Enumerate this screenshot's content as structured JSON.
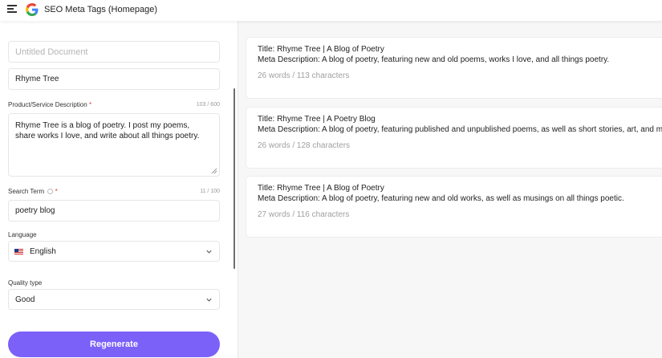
{
  "header": {
    "title": "SEO Meta Tags (Homepage)",
    "menu_icon": "hamburger-menu-icon",
    "logo": "google-logo"
  },
  "form": {
    "document_name": {
      "placeholder": "Untitled Document"
    },
    "business_name": {
      "value": "Rhyme Tree"
    },
    "description": {
      "label": "Product/Service Description",
      "required_mark": "*",
      "counter": "103 / 600",
      "value": "Rhyme Tree is a blog of poetry. I post my poems, share works I love, and write about all things poetry."
    },
    "search_term": {
      "label": "Search Term",
      "required_mark": "*",
      "counter": "11 / 100",
      "value": "poetry blog"
    },
    "language": {
      "label": "Language",
      "value": "English",
      "flag": "us-flag-icon"
    },
    "quality": {
      "label": "Quality type",
      "value": "Good"
    },
    "regenerate_label": "Regenerate"
  },
  "results": [
    {
      "title": "Title: Rhyme Tree | A Blog of Poetry",
      "meta": "Meta Description: A blog of poetry, featuring new and old poems, works I love, and all things poetry.",
      "stats": "26 words / 113 characters"
    },
    {
      "title": "Title: Rhyme Tree | A Poetry Blog",
      "meta": "Meta Description: A blog of poetry, featuring published and unpublished poems, as well as short stories, art, and more.",
      "stats": "26 words / 128 characters"
    },
    {
      "title": "Title: Rhyme Tree | A Blog of Poetry",
      "meta": "Meta Description: A blog of poetry, featuring new and old works, as well as musings on all things poetic.",
      "stats": "27 words / 116 characters"
    }
  ],
  "colors": {
    "accent": "#7b61f8",
    "required": "#e53935",
    "muted_text": "#a0a0a0",
    "panel_background": "#f7f7f8"
  }
}
